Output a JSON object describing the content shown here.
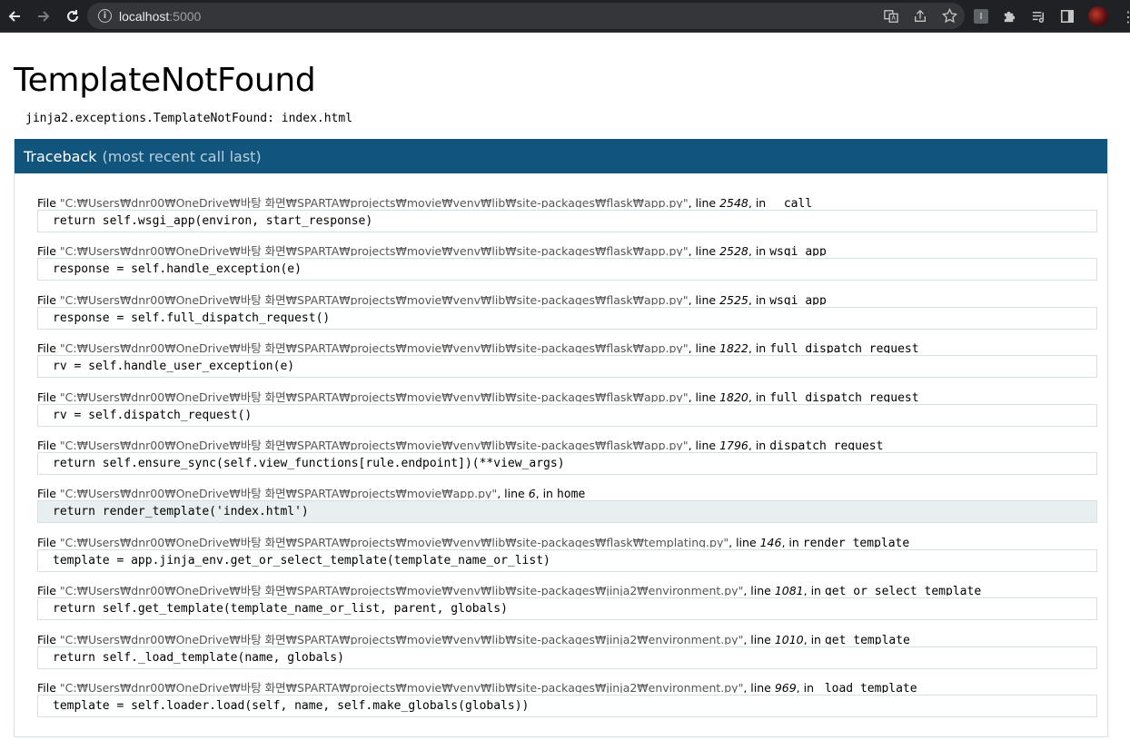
{
  "browser": {
    "back_icon": "arrow-left-icon",
    "forward_icon": "arrow-right-icon",
    "reload_icon": "reload-icon",
    "url_host": "localhost",
    "url_port": ":5000"
  },
  "page": {
    "title": "TemplateNotFound",
    "error_message": "jinja2.exceptions.TemplateNotFound: index.html",
    "traceback_title": "Traceback",
    "traceback_subtitle": "(most recent call last)"
  },
  "frames": [
    {
      "file": "\"C:₩Users₩dnr00₩OneDrive₩바탕 화면₩SPARTA₩projects₩movie₩venv₩lib₩site-packages₩flask₩app.py\"",
      "line": "2548",
      "func": "__call__",
      "code": "return self.wsgi_app(environ, start_response)",
      "current": false
    },
    {
      "file": "\"C:₩Users₩dnr00₩OneDrive₩바탕 화면₩SPARTA₩projects₩movie₩venv₩lib₩site-packages₩flask₩app.py\"",
      "line": "2528",
      "func": "wsgi_app",
      "code": "response = self.handle_exception(e)",
      "current": false
    },
    {
      "file": "\"C:₩Users₩dnr00₩OneDrive₩바탕 화면₩SPARTA₩projects₩movie₩venv₩lib₩site-packages₩flask₩app.py\"",
      "line": "2525",
      "func": "wsgi_app",
      "code": "response = self.full_dispatch_request()",
      "current": false
    },
    {
      "file": "\"C:₩Users₩dnr00₩OneDrive₩바탕 화면₩SPARTA₩projects₩movie₩venv₩lib₩site-packages₩flask₩app.py\"",
      "line": "1822",
      "func": "full_dispatch_request",
      "code": "rv = self.handle_user_exception(e)",
      "current": false
    },
    {
      "file": "\"C:₩Users₩dnr00₩OneDrive₩바탕 화면₩SPARTA₩projects₩movie₩venv₩lib₩site-packages₩flask₩app.py\"",
      "line": "1820",
      "func": "full_dispatch_request",
      "code": "rv = self.dispatch_request()",
      "current": false
    },
    {
      "file": "\"C:₩Users₩dnr00₩OneDrive₩바탕 화면₩SPARTA₩projects₩movie₩venv₩lib₩site-packages₩flask₩app.py\"",
      "line": "1796",
      "func": "dispatch_request",
      "code": "return self.ensure_sync(self.view_functions[rule.endpoint])(**view_args)",
      "current": false
    },
    {
      "file": "\"C:₩Users₩dnr00₩OneDrive₩바탕 화면₩SPARTA₩projects₩movie₩app.py\"",
      "line": "6",
      "func": "home",
      "code": "return render_template('index.html')",
      "current": true
    },
    {
      "file": "\"C:₩Users₩dnr00₩OneDrive₩바탕 화면₩SPARTA₩projects₩movie₩venv₩lib₩site-packages₩flask₩templating.py\"",
      "line": "146",
      "func": "render_template",
      "code": "template = app.jinja_env.get_or_select_template(template_name_or_list)",
      "current": false
    },
    {
      "file": "\"C:₩Users₩dnr00₩OneDrive₩바탕 화면₩SPARTA₩projects₩movie₩venv₩lib₩site-packages₩jinja2₩environment.py\"",
      "line": "1081",
      "func": "get_or_select_template",
      "code": "return self.get_template(template_name_or_list, parent, globals)",
      "current": false
    },
    {
      "file": "\"C:₩Users₩dnr00₩OneDrive₩바탕 화면₩SPARTA₩projects₩movie₩venv₩lib₩site-packages₩jinja2₩environment.py\"",
      "line": "1010",
      "func": "get_template",
      "code": "return self._load_template(name, globals)",
      "current": false
    },
    {
      "file": "\"C:₩Users₩dnr00₩OneDrive₩바탕 화면₩SPARTA₩projects₩movie₩venv₩lib₩site-packages₩jinja2₩environment.py\"",
      "line": "969",
      "func": "_load_template",
      "code": "template = self.loader.load(self, name, self.make_globals(globals))",
      "current": false
    }
  ],
  "labels": {
    "file": "File ",
    "line": ", line ",
    "in": ", in "
  },
  "colors": {
    "traceback_header": "#11557c",
    "code_border": "#d7e0e4",
    "current_line_bg": "#e8eff1"
  }
}
